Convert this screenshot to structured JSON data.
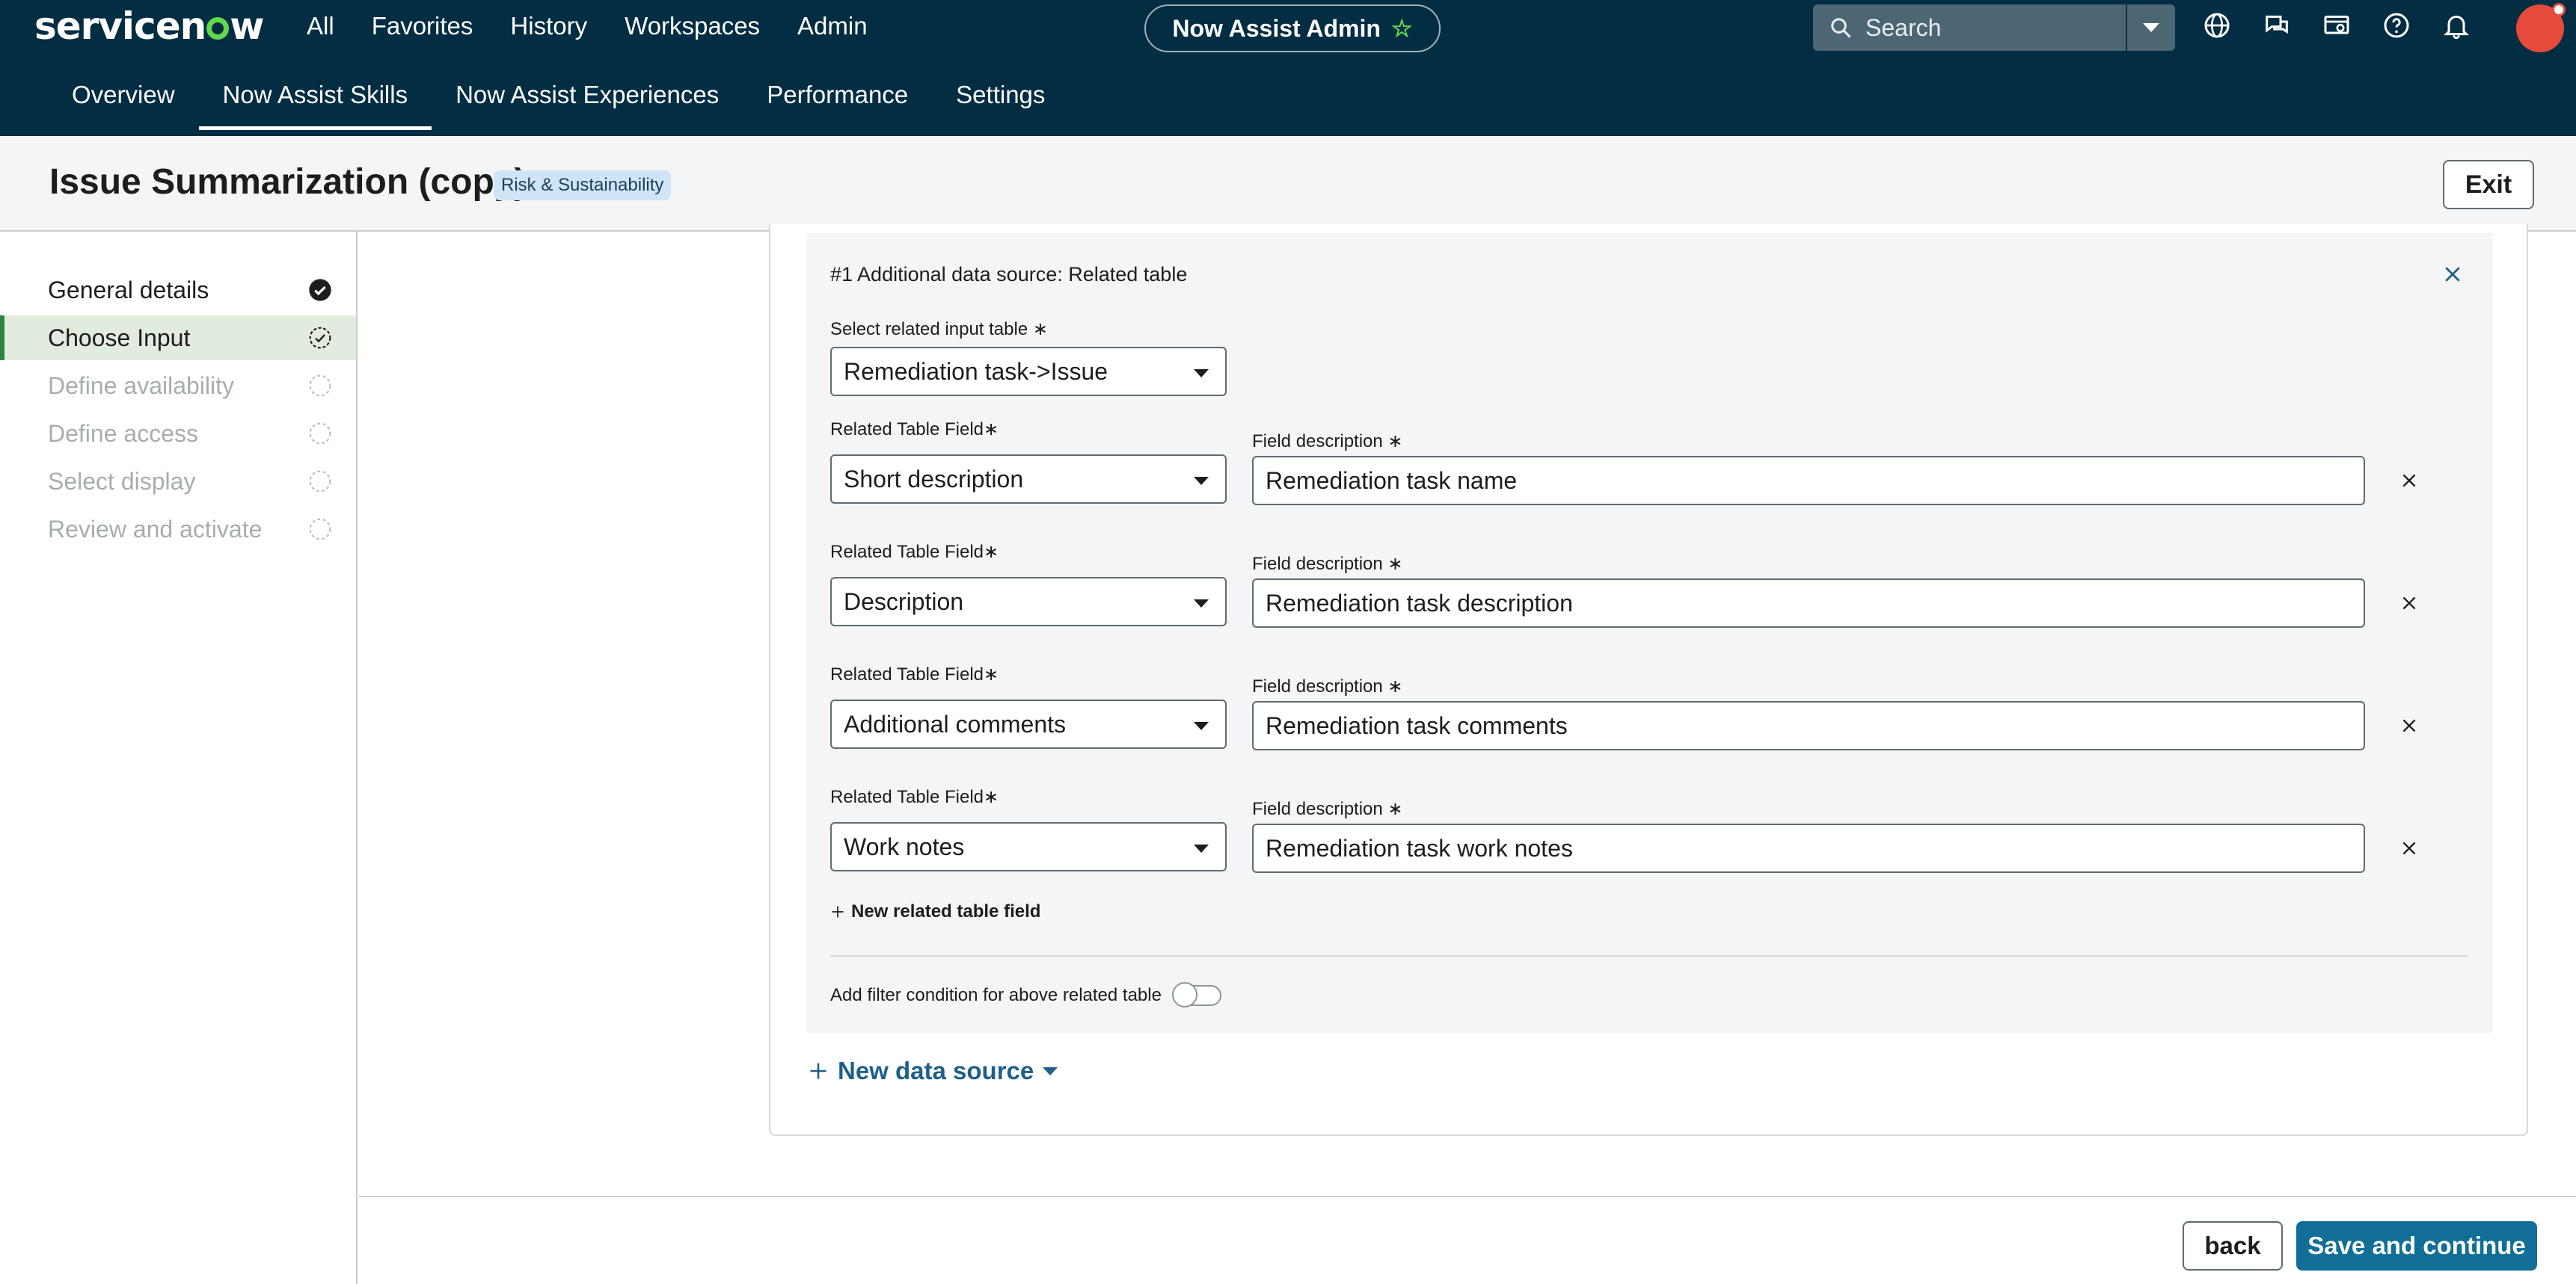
{
  "app": {
    "logo_text_before": "servicen",
    "logo_text_after": "w",
    "nav": [
      "All",
      "Favorites",
      "History",
      "Workspaces",
      "Admin"
    ],
    "workspace_pill": "Now Assist Admin",
    "search_placeholder": "Search",
    "avatar_initials": "",
    "subnav": [
      {
        "label": "Overview",
        "active": false
      },
      {
        "label": "Now Assist Skills",
        "active": true
      },
      {
        "label": "Now Assist Experiences",
        "active": false
      },
      {
        "label": "Performance",
        "active": false
      },
      {
        "label": "Settings",
        "active": false
      }
    ],
    "icons": [
      "globe-icon",
      "chat-icon",
      "screen-icon",
      "help-icon",
      "bell-icon"
    ]
  },
  "header": {
    "title": "Issue Summarization (copy)",
    "badge": "Risk & Sustainability",
    "exit_label": "Exit"
  },
  "steps": [
    {
      "label": "General details",
      "state": "complete"
    },
    {
      "label": "Choose Input",
      "state": "active"
    },
    {
      "label": "Define availability",
      "state": "pending"
    },
    {
      "label": "Define access",
      "state": "pending"
    },
    {
      "label": "Select display",
      "state": "pending"
    },
    {
      "label": "Review and activate",
      "state": "pending"
    }
  ],
  "datasource": {
    "title": "#1 Additional data source: Related table",
    "related_input_label": "Select related input table",
    "related_input_value": "Remediation task->Issue",
    "field_label": "Related Table Field",
    "description_label": "Field description",
    "required_mark": "∗",
    "fields": [
      {
        "field": "Short description",
        "description": "Remediation task name"
      },
      {
        "field": "Description",
        "description": "Remediation task description"
      },
      {
        "field": "Additional comments",
        "description": "Remediation task comments"
      },
      {
        "field": "Work notes",
        "description": "Remediation task work notes"
      }
    ],
    "new_field_label": "New related table field",
    "filter_label": "Add filter condition for above related table",
    "filter_enabled": false
  },
  "new_datasource_label": "New data source",
  "footer": {
    "back_label": "back",
    "save_label": "Save and continue"
  },
  "colors": {
    "topbar": "#032d42",
    "accent": "#106e97",
    "active_step": "#2e8540"
  }
}
